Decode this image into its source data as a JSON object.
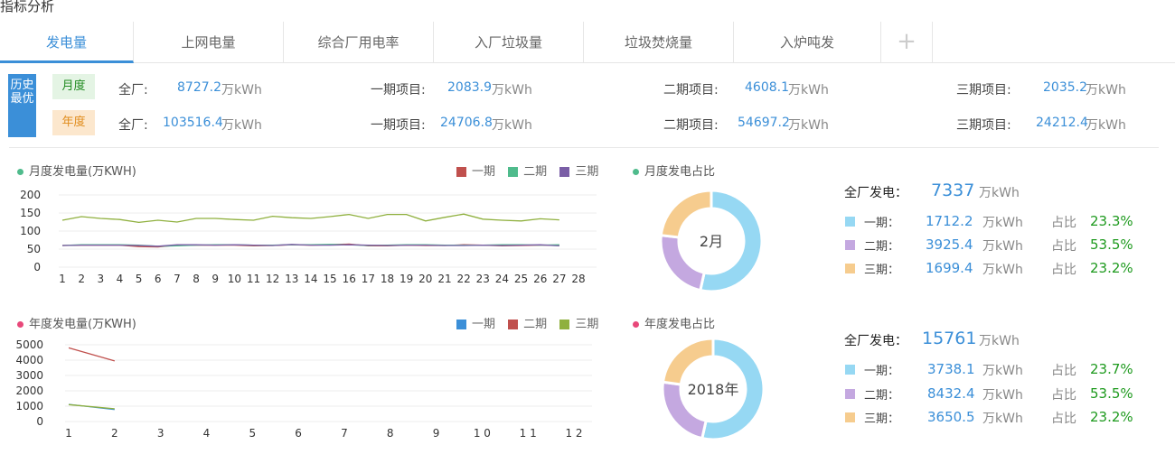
{
  "page_title": "指标分析",
  "tabs": [
    {
      "label": "发电量",
      "active": true
    },
    {
      "label": "上网电量",
      "active": false
    },
    {
      "label": "综合厂用电率",
      "active": false
    },
    {
      "label": "入厂垃圾量",
      "active": false
    },
    {
      "label": "垃圾焚烧量",
      "active": false
    },
    {
      "label": "入炉吨发",
      "active": false
    }
  ],
  "tab_add_icon": "+",
  "history_best": {
    "badge": "历史最优",
    "monthly": {
      "label": "月度",
      "items": [
        {
          "name": "全厂:",
          "value": "8727.2",
          "unit": "万kWh"
        },
        {
          "name": "一期项目:",
          "value": "2083.9",
          "unit": "万kWh"
        },
        {
          "name": "二期项目:",
          "value": "4608.1",
          "unit": "万kWh"
        },
        {
          "name": "三期项目:",
          "value": "2035.2",
          "unit": "万kWh"
        }
      ]
    },
    "yearly": {
      "label": "年度",
      "items": [
        {
          "name": "全厂:",
          "value": "103516.4",
          "unit": "万kWh"
        },
        {
          "name": "一期项目:",
          "value": "24706.8",
          "unit": "万kWh"
        },
        {
          "name": "二期项目:",
          "value": "54697.2",
          "unit": "万kWh"
        },
        {
          "name": "三期项目:",
          "value": "24212.4",
          "unit": "万kWh"
        }
      ]
    }
  },
  "colors": {
    "accent": "#3b8fd8",
    "phase1_red": "#c0504d",
    "phase2_green": "#4fbb8c",
    "phase3_purple": "#7a5ea6",
    "green_line": "#8fb03e",
    "blue": "#3b8fd8",
    "donut_blue": "#96d8f3",
    "donut_purple": "#c4a8e0",
    "donut_orange": "#f6cc8e",
    "monthly_dot": "#4fbb8c",
    "yearly_dot": "#e8487a"
  },
  "monthly_chart": {
    "title": "月度发电量(万KWH)",
    "legend": [
      {
        "label": "一期",
        "color": "#c0504d"
      },
      {
        "label": "二期",
        "color": "#4fbb8c"
      },
      {
        "label": "三期",
        "color": "#7a5ea6"
      }
    ]
  },
  "yearly_chart": {
    "title": "年度发电量(万KWH)",
    "legend": [
      {
        "label": "一期",
        "color": "#3b8fd8"
      },
      {
        "label": "二期",
        "color": "#c0504d"
      },
      {
        "label": "三期",
        "color": "#8fb03e"
      }
    ]
  },
  "chart_data": [
    {
      "type": "line",
      "title": "月度发电量(万KWH)",
      "x": [
        1,
        2,
        3,
        4,
        5,
        6,
        7,
        8,
        9,
        10,
        11,
        12,
        13,
        14,
        15,
        16,
        17,
        18,
        19,
        20,
        21,
        22,
        23,
        24,
        25,
        26,
        27,
        28
      ],
      "ylim": [
        0,
        200
      ],
      "yticks": [
        0,
        50,
        100,
        150,
        200
      ],
      "grid": true,
      "legend_position": "top-right",
      "series": [
        {
          "name": "一期",
          "color": "#c0504d",
          "values": [
            60,
            61,
            61,
            61,
            57,
            56,
            61,
            61,
            61,
            61,
            59,
            60,
            62,
            61,
            62,
            64,
            59,
            59,
            61,
            60,
            60,
            62,
            61,
            59,
            60,
            61,
            61,
            null
          ]
        },
        {
          "name": "二期",
          "color": "#4fbb8c",
          "values": [
            60,
            62,
            62,
            62,
            61,
            58,
            59,
            61,
            62,
            62,
            61,
            61,
            62,
            62,
            63,
            62,
            60,
            61,
            62,
            62,
            61,
            61,
            61,
            62,
            62,
            61,
            62,
            null
          ]
        },
        {
          "name": "三期",
          "color": "#7a5ea6",
          "values": [
            60,
            61,
            61,
            61,
            60,
            58,
            62,
            62,
            61,
            62,
            61,
            60,
            63,
            61,
            61,
            62,
            61,
            60,
            61,
            61,
            60,
            60,
            61,
            60,
            61,
            62,
            59,
            null
          ]
        },
        {
          "name": "",
          "color": "#8fb03e",
          "values": [
            130,
            140,
            135,
            132,
            124,
            130,
            125,
            135,
            135,
            132,
            130,
            141,
            137,
            135,
            140,
            146,
            135,
            146,
            146,
            128,
            138,
            147,
            133,
            130,
            128,
            134,
            131,
            null
          ]
        }
      ]
    },
    {
      "type": "pie",
      "title": "月度发电占比",
      "center_label": "2月",
      "total_label": "全厂发电：",
      "total_value": "7337",
      "total_unit": "万kWh",
      "slices": [
        {
          "name": "一期：",
          "value": "1712.2",
          "unit": "万kWh",
          "pct_label": "占比",
          "pct": "23.3%",
          "color": "#96d8f3",
          "share": 0.535
        },
        {
          "name": "二期：",
          "value": "3925.4",
          "unit": "万kWh",
          "pct_label": "占比",
          "pct": "53.5%",
          "color": "#c4a8e0",
          "share": 0.233
        },
        {
          "name": "三期：",
          "value": "1699.4",
          "unit": "万kWh",
          "pct_label": "占比",
          "pct": "23.2%",
          "color": "#f6cc8e",
          "share": 0.232
        }
      ]
    },
    {
      "type": "line",
      "title": "年度发电量(万KWH)",
      "x": [
        1,
        2,
        3,
        4,
        5,
        6,
        7,
        8,
        9,
        10,
        11,
        12
      ],
      "xtick_labels": [
        "1",
        "2",
        "3",
        "4",
        "5",
        "6",
        "7",
        "8",
        "9",
        "1 0",
        "1 1",
        "1 2"
      ],
      "ylim": [
        0,
        5000
      ],
      "yticks": [
        0,
        1000,
        2000,
        3000,
        4000,
        5000
      ],
      "grid": true,
      "legend_position": "top-right",
      "series": [
        {
          "name": "一期",
          "color": "#3b8fd8",
          "values": [
            1120,
            780
          ]
        },
        {
          "name": "二期",
          "color": "#c0504d",
          "values": [
            4800,
            3950
          ]
        },
        {
          "name": "三期",
          "color": "#8fb03e",
          "values": [
            1100,
            830
          ]
        }
      ]
    },
    {
      "type": "pie",
      "title": "年度发电占比",
      "center_label": "2018年",
      "total_label": "全厂发电：",
      "total_value": "15761",
      "total_unit": "万kWh",
      "slices": [
        {
          "name": "一期：",
          "value": "3738.1",
          "unit": "万kWh",
          "pct_label": "占比",
          "pct": "23.7%",
          "color": "#96d8f3",
          "share": 0.535
        },
        {
          "name": "二期：",
          "value": "8432.4",
          "unit": "万kWh",
          "pct_label": "占比",
          "pct": "53.5%",
          "color": "#c4a8e0",
          "share": 0.237
        },
        {
          "name": "三期：",
          "value": "3650.5",
          "unit": "万kWh",
          "pct_label": "占比",
          "pct": "23.2%",
          "color": "#f6cc8e",
          "share": 0.228
        }
      ]
    }
  ]
}
